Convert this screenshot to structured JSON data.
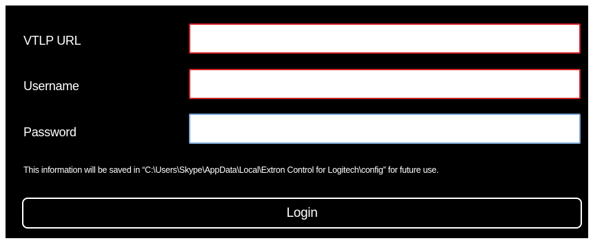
{
  "form": {
    "vtlp_url": {
      "label": "VTLP URL",
      "value": "",
      "status_color": "#d2232a"
    },
    "username": {
      "label": "Username",
      "value": "",
      "status_color": "#d2232a"
    },
    "password": {
      "label": "Password",
      "value": "",
      "status_color": "#7ea8d8"
    },
    "info_text": "This information will be saved in “C:\\Users\\Skype\\AppData\\Local\\Extron Control for Logitech\\config” for future use.",
    "login_label": "Login"
  },
  "colors": {
    "background": "#000000",
    "text": "#ffffff",
    "invalid_border": "#d2232a",
    "focus_border": "#7ea8d8"
  }
}
